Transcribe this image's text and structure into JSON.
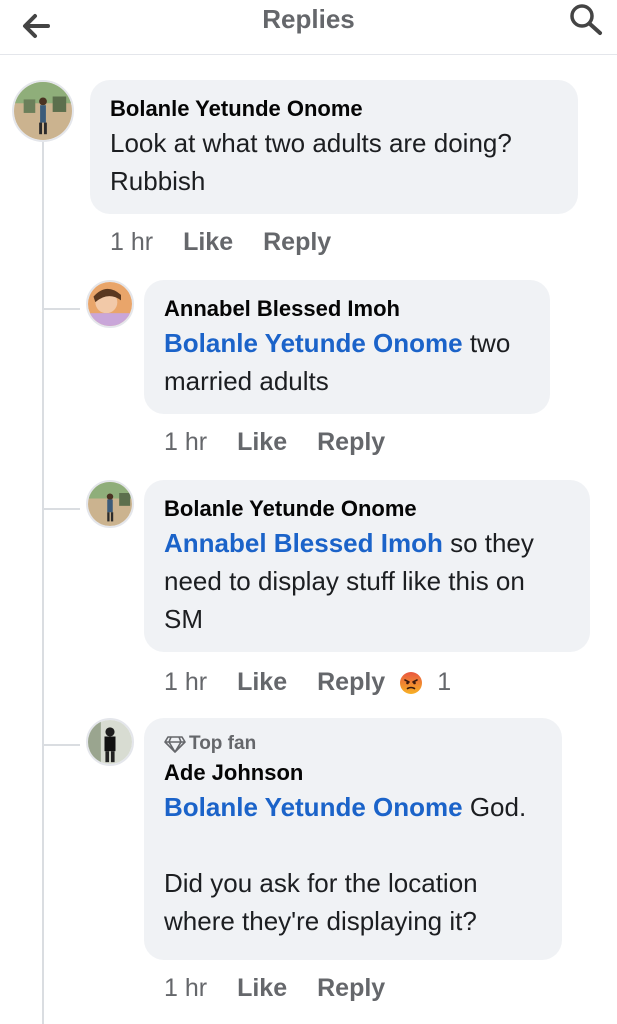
{
  "header": {
    "title": "Replies"
  },
  "comments": [
    {
      "author": "Bolanle Yetunde Onome",
      "text_line1": "Look at what two adults are doing?",
      "text_line2": "Rubbish",
      "time": "1 hr",
      "like": "Like",
      "reply": "Reply"
    },
    {
      "author": "Annabel Blessed Imoh",
      "mention": "Bolanle Yetunde Onome",
      "text_after_mention": " two",
      "text_line2": "married adults",
      "time": "1 hr",
      "like": "Like",
      "reply": "Reply"
    },
    {
      "author": "Bolanle Yetunde Onome",
      "mention": "Annabel Blessed Imoh",
      "text_after_mention": " so they",
      "text_line2": "need to display stuff like this on",
      "text_line3": "SM",
      "time": "1 hr",
      "like": "Like",
      "reply": "Reply",
      "reaction_icon": "angry-emoji",
      "reaction_count": "1"
    },
    {
      "badge": "Top fan",
      "author": "Ade Johnson",
      "mention": "Bolanle Yetunde Onome",
      "text_after_mention": " God.",
      "text_line3": "Did you ask for the location",
      "text_line4": "where they're displaying it?",
      "time": "1 hr",
      "like": "Like",
      "reply": "Reply"
    }
  ],
  "colors": {
    "mention": "#1b63c9",
    "bubble": "#f0f2f5",
    "meta": "#65676b"
  }
}
